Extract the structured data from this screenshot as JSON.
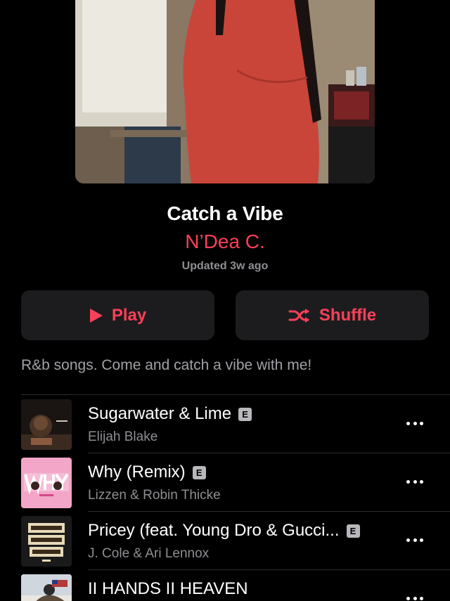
{
  "playlist": {
    "title": "Catch a Vibe",
    "curator": "N’Dea C.",
    "updated": "Updated 3w ago",
    "description": "R&b songs. Come and catch a vibe with me!"
  },
  "actions": {
    "play_label": "Play",
    "shuffle_label": "Shuffle"
  },
  "colors": {
    "accent": "#fa4058",
    "background": "#000000",
    "button_bg": "#1c1c1e",
    "secondary_text": "#8e8e93"
  },
  "icons": {
    "play": "play-icon",
    "shuffle": "shuffle-icon",
    "more": "more-icon",
    "explicit": "explicit-badge"
  },
  "tracks": [
    {
      "title": "Sugarwater & Lime",
      "artist": "Elijah Blake",
      "explicit": "E"
    },
    {
      "title": "Why (Remix)",
      "artist": "Lizzen & Robin Thicke",
      "explicit": "E"
    },
    {
      "title": "Pricey (feat. Young Dro & Gucci...",
      "artist": "J. Cole & Ari Lennox",
      "explicit": "E"
    },
    {
      "title": "II HANDS II HEAVEN",
      "artist": "",
      "explicit": ""
    }
  ]
}
